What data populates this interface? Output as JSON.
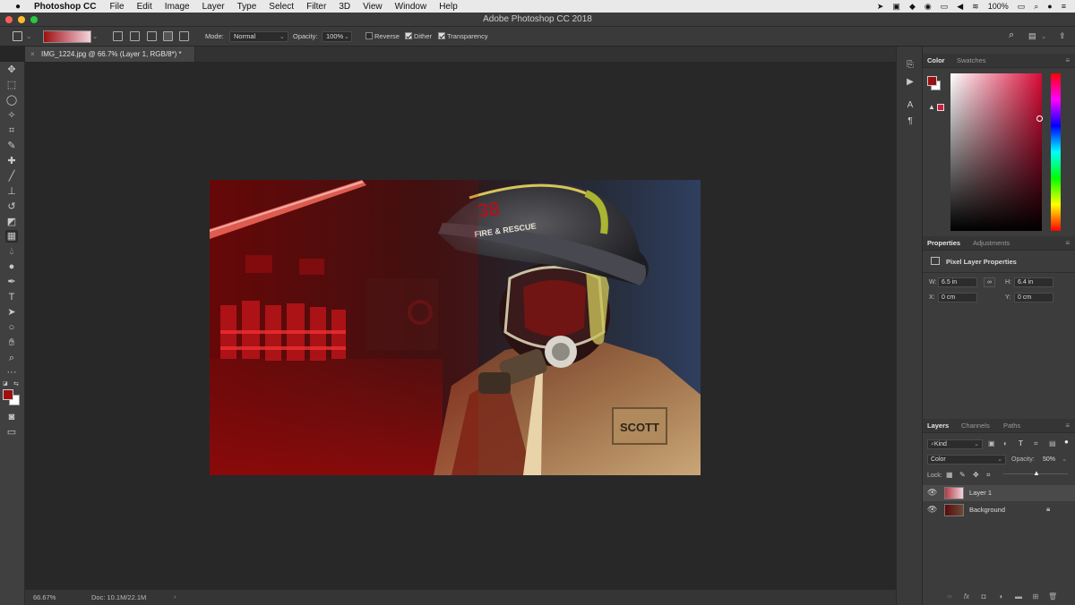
{
  "menubar": {
    "app": "Photoshop CC",
    "items": [
      "File",
      "Edit",
      "Image",
      "Layer",
      "Type",
      "Select",
      "Filter",
      "3D",
      "View",
      "Window",
      "Help"
    ],
    "battery": "100%"
  },
  "window": {
    "title": "Adobe Photoshop CC 2018"
  },
  "options": {
    "mode_label": "Mode:",
    "mode_value": "Normal",
    "opacity_label": "Opacity:",
    "opacity_value": "100%",
    "reverse": "Reverse",
    "dither": "Dither",
    "transparency": "Transparency"
  },
  "document": {
    "tab": "IMG_1224.jpg @ 66.7% (Layer 1, RGB/8*) *"
  },
  "status": {
    "zoom": "66.67%",
    "doc": "Doc: 10.1M/22.1M"
  },
  "artwork": {
    "helmet_number": "38",
    "helmet_text": "FIRE & RESCUE",
    "patch_text": "SCOTT"
  },
  "color_panel": {
    "tab_color": "Color",
    "tab_swatches": "Swatches",
    "foreground": "#9b1111",
    "background": "#ffffff"
  },
  "properties": {
    "tab_properties": "Properties",
    "tab_adjustments": "Adjustments",
    "title": "Pixel Layer Properties",
    "w_label": "W:",
    "w_value": "6.5 in",
    "h_label": "H:",
    "h_value": "6.4 in",
    "x_label": "X:",
    "x_value": "0 cm",
    "y_label": "Y:",
    "y_value": "0 cm"
  },
  "layers": {
    "tab_layers": "Layers",
    "tab_channels": "Channels",
    "tab_paths": "Paths",
    "kind": "Kind",
    "blend": "Color",
    "opacity_label": "Opacity:",
    "opacity_value": "50%",
    "lock_label": "Lock:",
    "items": [
      {
        "name": "Layer 1"
      },
      {
        "name": "Background"
      }
    ]
  }
}
